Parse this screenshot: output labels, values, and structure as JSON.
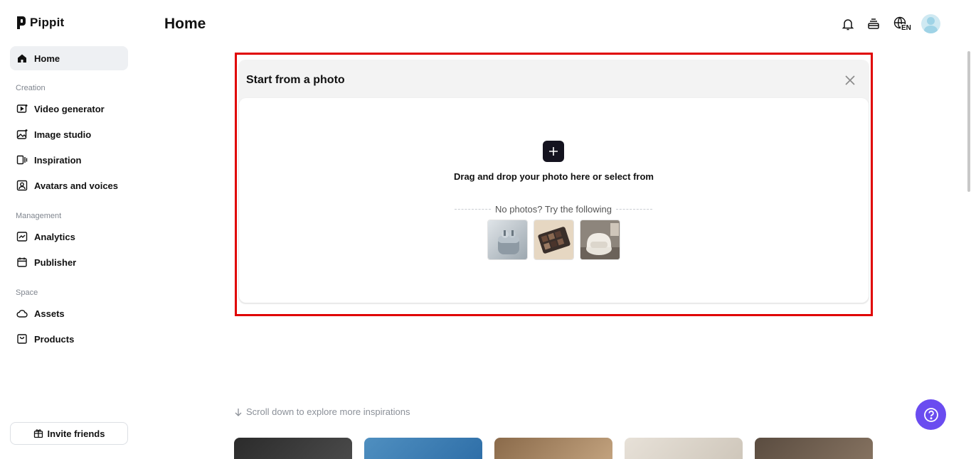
{
  "app": {
    "name": "Pippit"
  },
  "sidebar": {
    "home": "Home",
    "sections": [
      {
        "label": "Creation",
        "items": [
          "Video generator",
          "Image studio",
          "Inspiration",
          "Avatars and voices"
        ]
      },
      {
        "label": "Management",
        "items": [
          "Analytics",
          "Publisher"
        ]
      },
      {
        "label": "Space",
        "items": [
          "Assets",
          "Products"
        ]
      }
    ],
    "invite_label": "Invite friends"
  },
  "header": {
    "title": "Home",
    "language": "EN"
  },
  "panel": {
    "title": "Start from a photo",
    "drop_text": "Drag and drop your photo here or select from",
    "try_text": "No photos? Try the following",
    "samples": [
      "earbuds-photo",
      "eyeshadow-palette-photo",
      "armchair-photo"
    ]
  },
  "scroll_hint": "Scroll down to explore more inspirations",
  "colors": {
    "accent": "#6a4cf0",
    "highlight": "#e00000",
    "dark": "#14131f"
  }
}
